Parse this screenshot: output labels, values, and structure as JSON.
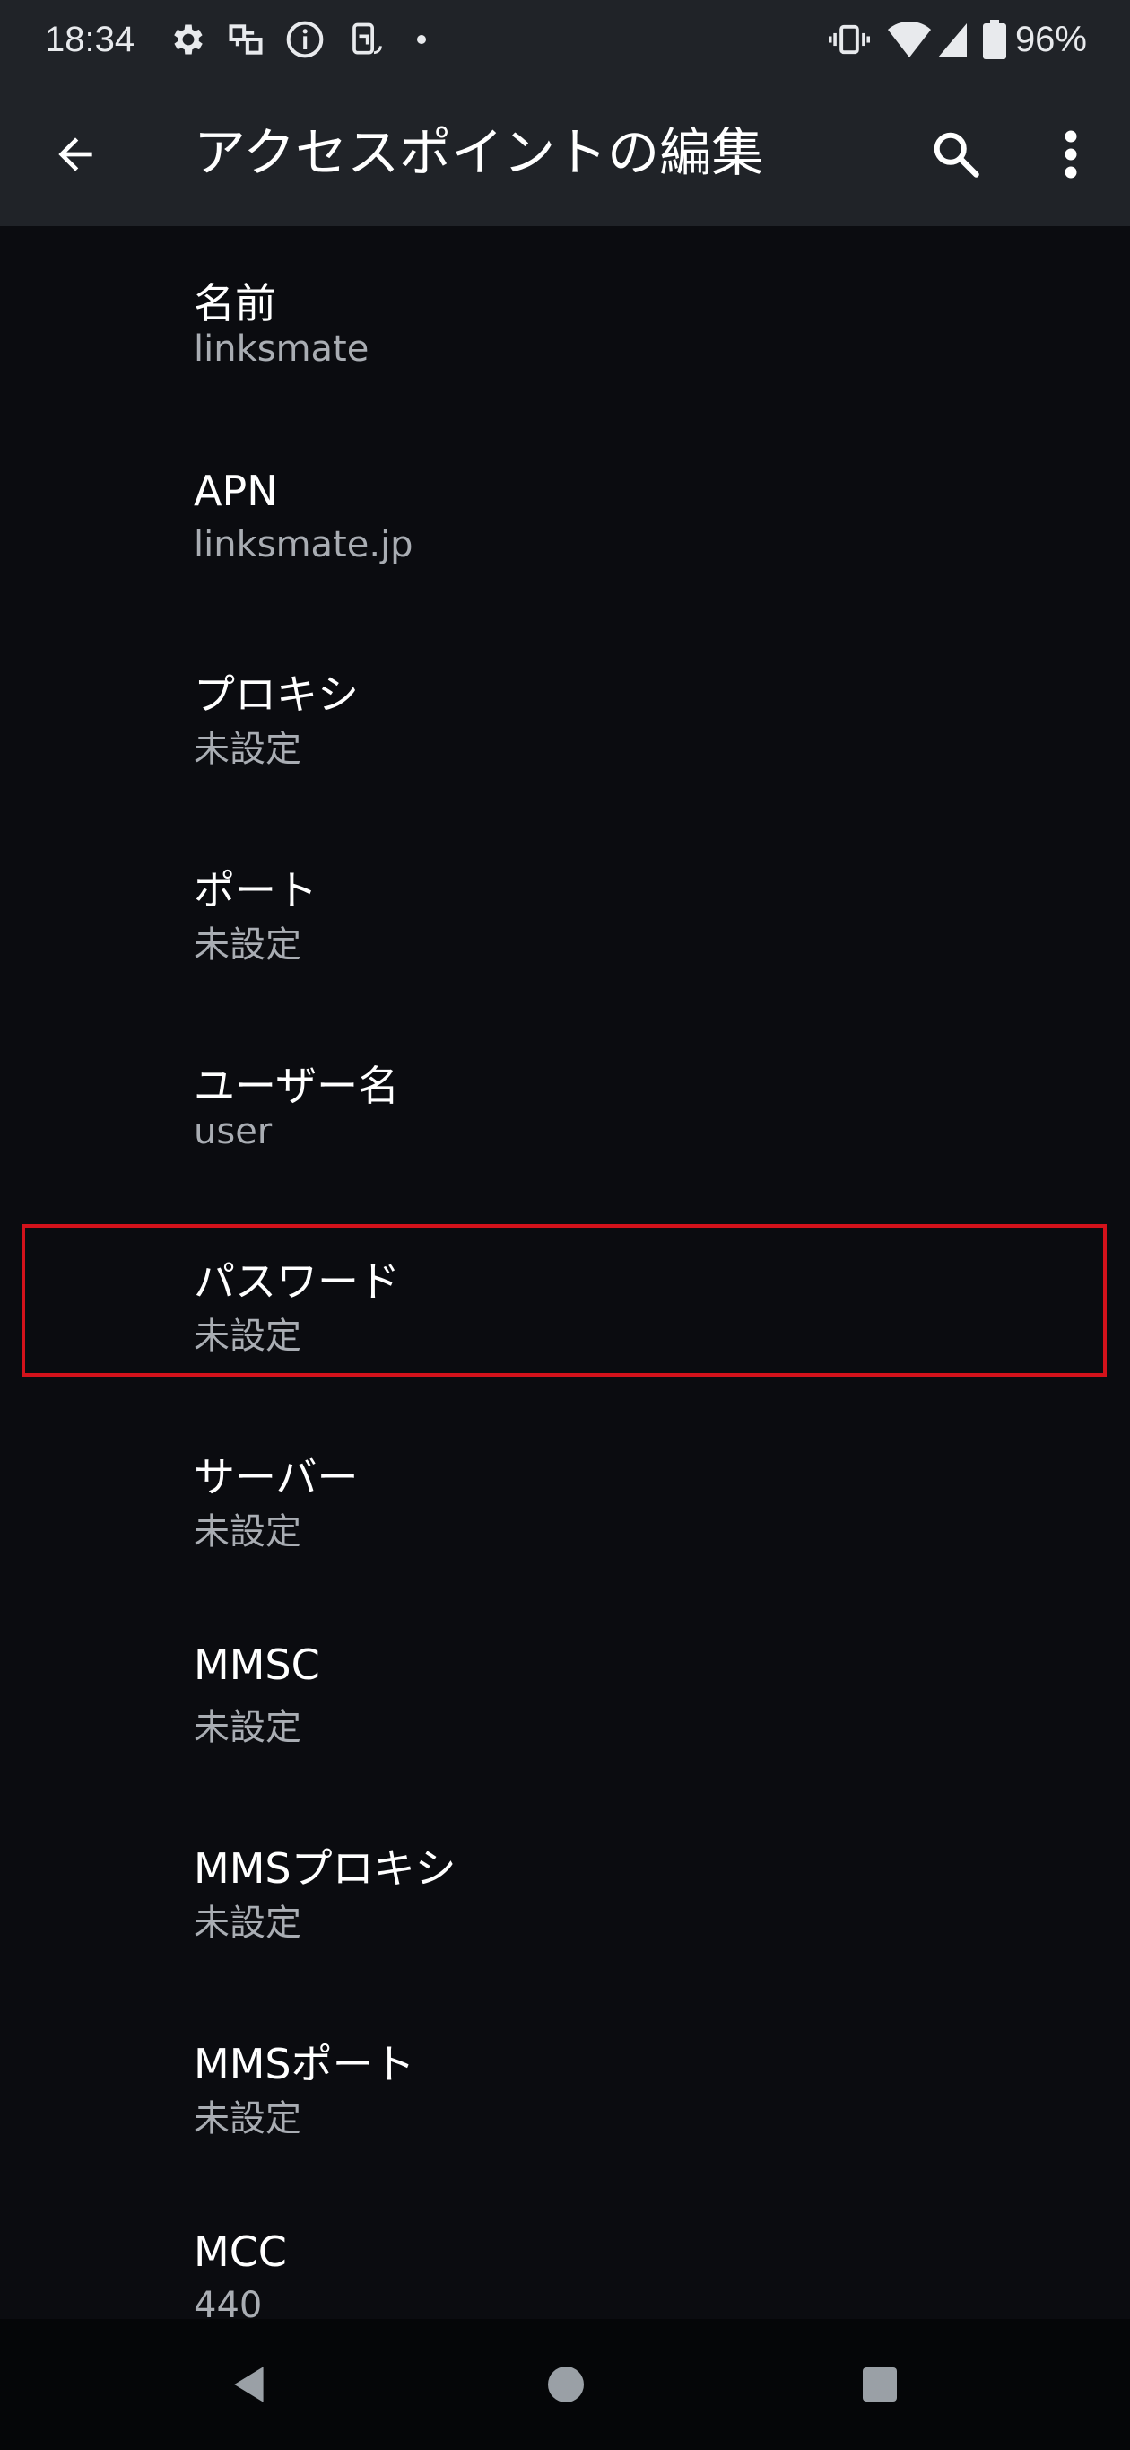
{
  "status_bar": {
    "time": "18:34",
    "battery_percent": "96%",
    "icons": [
      "gear-icon",
      "vpn-key-icon",
      "info-icon",
      "screen-rotate-icon",
      "dot-icon",
      "vibrate-icon",
      "wifi-icon",
      "battery-icon"
    ]
  },
  "app_bar": {
    "title": "アクセスポイントの編集",
    "back_icon": "arrow-left-icon",
    "search_icon": "search-icon",
    "more_icon": "more-vert-icon"
  },
  "prefs": [
    {
      "title": "名前",
      "summary": "linksmate"
    },
    {
      "title": "APN",
      "summary": "linksmate.jp"
    },
    {
      "title": "プロキシ",
      "summary": "未設定"
    },
    {
      "title": "ポート",
      "summary": "未設定"
    },
    {
      "title": "ユーザー名",
      "summary": "user"
    },
    {
      "title": "パスワード",
      "summary": "未設定"
    },
    {
      "title": "サーバー",
      "summary": "未設定"
    },
    {
      "title": "MMSC",
      "summary": "未設定"
    },
    {
      "title": "MMSプロキシ",
      "summary": "未設定"
    },
    {
      "title": "MMSポート",
      "summary": "未設定"
    },
    {
      "title": "MCC",
      "summary": "440"
    }
  ],
  "highlighted_item": "パスワード",
  "colors": {
    "background": "#0b0c10",
    "app_bar": "#202328",
    "highlight": "#d3121b",
    "summary_text": "#a9adb3"
  },
  "nav_bar": {
    "icons": [
      "back-triangle-icon",
      "home-circle-icon",
      "recents-square-icon"
    ]
  }
}
